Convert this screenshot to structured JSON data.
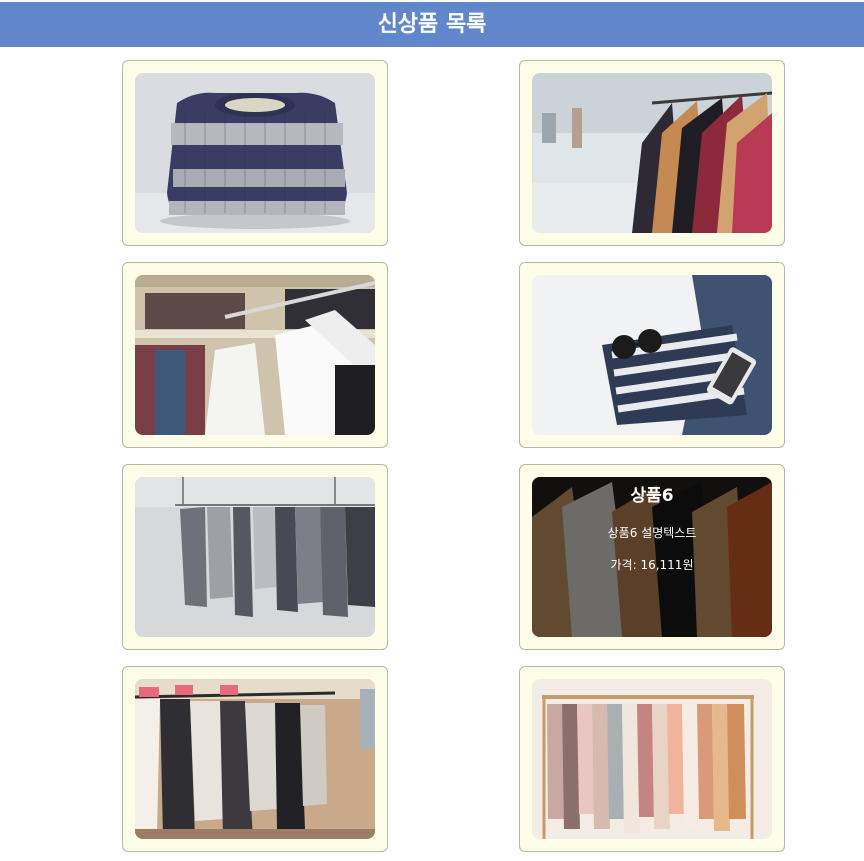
{
  "header": {
    "title": "신상품 목록"
  },
  "products": [
    {
      "image": "knit-sweater-photo"
    },
    {
      "image": "clothing-rack-store-photo"
    },
    {
      "image": "white-shirts-closet-photo"
    },
    {
      "image": "striped-shirt-jeans-sunglasses-photo"
    },
    {
      "image": "grey-clothes-rack-photo"
    },
    {
      "image": "jackets-on-wooden-hangers-photo",
      "name": "상품6",
      "description": "상품6 설명텍스트",
      "price": "가격: 16,111원"
    },
    {
      "image": "boutique-dresses-rack-photo"
    },
    {
      "image": "pastel-garments-rack-photo"
    }
  ],
  "colors": {
    "header_bg": "#5f87c9",
    "card_bg": "#fefde8",
    "card_border": "#b9b7a6"
  }
}
